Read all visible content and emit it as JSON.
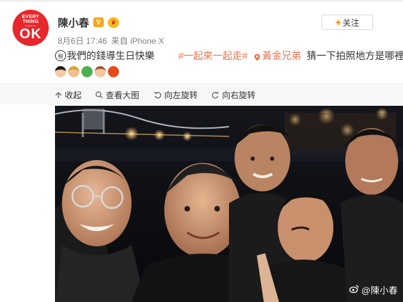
{
  "header": {
    "avatar_text": [
      "EVERY",
      "THING",
      "is gonna be",
      "OK"
    ],
    "name": "陳小春",
    "verified_icon": "verified-v-icon",
    "member_icon": "member-badge-icon",
    "timestamp": "8月6日 17:46",
    "source_prefix": "来自",
    "source": "iPhone X",
    "follow_label": "关注"
  },
  "post": {
    "emoji_prefix": "㊗",
    "text_main": "我們的錢導生日快樂",
    "tag1": "#一起來一起走#",
    "mention": "黃金兄弟",
    "text_tail": "猜一下拍照地方是哪裡",
    "emojis": [
      "man-black-hair-emoji",
      "man-blond-emoji",
      "green-face-emoji",
      "man-brown-hair-emoji",
      "red-face-emoji"
    ]
  },
  "toolbar": {
    "collapse": "收起",
    "view_large": "查看大图",
    "rotate_left": "向左旋转",
    "rotate_right": "向右旋转"
  },
  "photo": {
    "watermark": "@陳小春",
    "description_icon": "selfie-photo"
  },
  "colors": {
    "accent": "#ff8200",
    "link": "#eb7350",
    "avatar_red": "#e8262b",
    "meta_gray": "#808080"
  }
}
